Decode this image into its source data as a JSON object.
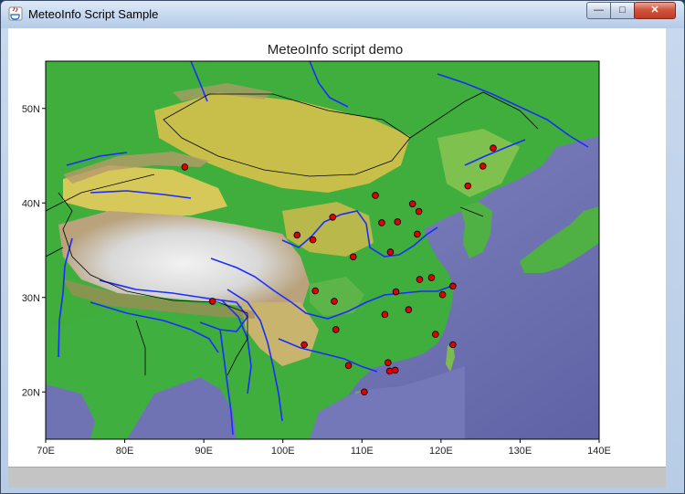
{
  "window": {
    "title": "MeteoInfo Script Sample",
    "buttons": {
      "minimize": "—",
      "maximize": "□",
      "close": "✕"
    }
  },
  "chart_data": {
    "type": "scatter",
    "title": "MeteoInfo script demo",
    "xlim": [
      70,
      140
    ],
    "ylim": [
      15,
      55
    ],
    "x_ticks": [
      "70E",
      "80E",
      "90E",
      "100E",
      "110E",
      "120E",
      "130E",
      "140E"
    ],
    "y_ticks": [
      "20N",
      "30N",
      "40N",
      "50N"
    ],
    "points": [
      {
        "lon": 87.6,
        "lat": 43.8
      },
      {
        "lon": 91.1,
        "lat": 29.6
      },
      {
        "lon": 101.8,
        "lat": 36.6
      },
      {
        "lon": 103.8,
        "lat": 36.1
      },
      {
        "lon": 106.3,
        "lat": 38.5
      },
      {
        "lon": 108.9,
        "lat": 34.3
      },
      {
        "lon": 111.7,
        "lat": 40.8
      },
      {
        "lon": 112.5,
        "lat": 37.9
      },
      {
        "lon": 114.5,
        "lat": 38.0
      },
      {
        "lon": 116.4,
        "lat": 39.9
      },
      {
        "lon": 117.2,
        "lat": 39.1
      },
      {
        "lon": 117.0,
        "lat": 36.7
      },
      {
        "lon": 113.6,
        "lat": 34.8
      },
      {
        "lon": 117.3,
        "lat": 31.9
      },
      {
        "lon": 118.8,
        "lat": 32.1
      },
      {
        "lon": 121.5,
        "lat": 31.2
      },
      {
        "lon": 120.2,
        "lat": 30.3
      },
      {
        "lon": 114.3,
        "lat": 30.6
      },
      {
        "lon": 112.9,
        "lat": 28.2
      },
      {
        "lon": 115.9,
        "lat": 28.7
      },
      {
        "lon": 119.3,
        "lat": 26.1
      },
      {
        "lon": 104.1,
        "lat": 30.7
      },
      {
        "lon": 106.5,
        "lat": 29.6
      },
      {
        "lon": 106.7,
        "lat": 26.6
      },
      {
        "lon": 102.7,
        "lat": 25.0
      },
      {
        "lon": 108.3,
        "lat": 22.8
      },
      {
        "lon": 113.3,
        "lat": 23.1
      },
      {
        "lon": 113.5,
        "lat": 22.2
      },
      {
        "lon": 114.2,
        "lat": 22.3
      },
      {
        "lon": 110.3,
        "lat": 20.0
      },
      {
        "lon": 121.5,
        "lat": 25.0
      },
      {
        "lon": 123.4,
        "lat": 41.8
      },
      {
        "lon": 125.3,
        "lat": 43.9
      },
      {
        "lon": 126.6,
        "lat": 45.8
      }
    ],
    "marker_color": "#e00000",
    "river_color": "#1a2cff",
    "border_color": "#000000",
    "grid": false
  }
}
